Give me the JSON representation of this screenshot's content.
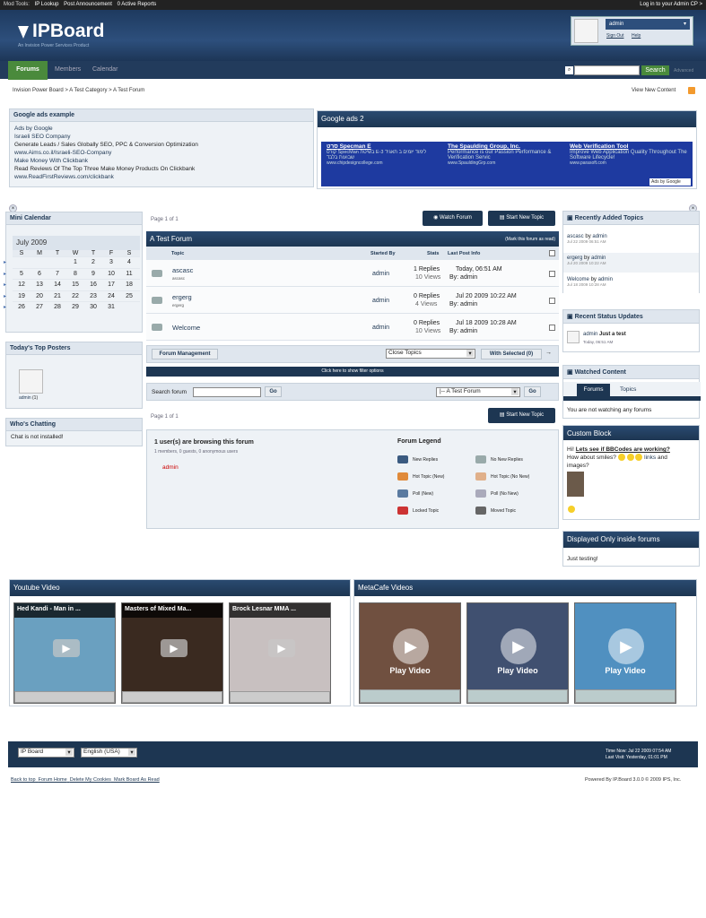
{
  "modbar": {
    "label": "Mod Tools:",
    "links": [
      "IP Lookup",
      "Post Announcement",
      "0 Active Reports"
    ],
    "right": "Log in to your Admin CP >"
  },
  "header": {
    "logo": "IPBoard",
    "logo_sub": "An Invision Power Services Product",
    "username": "admin",
    "sign_out": "Sign Out",
    "help": "Help"
  },
  "nav": {
    "tabs": [
      "Forums",
      "Members",
      "Calendar"
    ],
    "search_placeholder": "",
    "search_button": "Search",
    "advanced": "Advanced"
  },
  "breadcrumb": [
    "Invision Power Board",
    "A Test Category",
    "A Test Forum"
  ],
  "view_new": "View New Content",
  "google1": {
    "title": "Google ads example",
    "lines": [
      "Ads by Google",
      "Israeli SEO Company",
      "Generate Leads / Sales Globally SEO, PPC & Conversion Optimization",
      "www.Aims.co.il/Israeli-SEO-Company",
      "Make Money With Clickbank",
      "Read Reviews Of The Top Three Make Money Products On Clickbank",
      "www.ReadFirstReviews.com/clickbank"
    ]
  },
  "google2": {
    "title": "Google ads 2",
    "ads": [
      {
        "t": "סרט Specman E",
        "d": "קורס SpecMan בשיטת E-לימוד יזמים ב תאגיד 3 שבועות בלבד",
        "u": "www.chipdesigncollege.com"
      },
      {
        "t": "The Spaulding Group, Inc.",
        "d": "Performance is our Passion Performance & Verification Servic",
        "u": "www.SpauldingGrp.com"
      },
      {
        "t": "Web Verification Tool",
        "d": "Improve Web Application Quality Throughout The Software Lifecycle!",
        "u": "www.parasoft.com"
      }
    ],
    "footer": "Ads by Google"
  },
  "calendar": {
    "title": "Mini Calendar",
    "month": "July 2009",
    "days": [
      "S",
      "M",
      "T",
      "W",
      "T",
      "F",
      "S"
    ],
    "weeks": [
      [
        "",
        "",
        "",
        "1",
        "2",
        "3",
        "4"
      ],
      [
        "5",
        "6",
        "7",
        "8",
        "9",
        "10",
        "11"
      ],
      [
        "12",
        "13",
        "14",
        "15",
        "16",
        "17",
        "18"
      ],
      [
        "19",
        "20",
        "21",
        "22",
        "23",
        "24",
        "25"
      ],
      [
        "26",
        "27",
        "28",
        "29",
        "30",
        "31",
        ""
      ]
    ]
  },
  "top_posters": {
    "title": "Today's Top Posters",
    "name": "admin",
    "count": "(1)"
  },
  "chatting": {
    "title": "Who's Chatting",
    "text": "Chat is not installed!"
  },
  "forum": {
    "page": "Page 1 of 1",
    "watch": "Watch Forum",
    "start": "Start New Topic",
    "title": "A Test Forum",
    "mark": "(Mark this forum as read)",
    "cols": [
      "Topic",
      "Started By",
      "Stats",
      "Last Post Info"
    ],
    "topics": [
      {
        "name": "ascasc",
        "sub": "ascasc",
        "by": "admin",
        "replies": "1 Replies",
        "views": "10 Views",
        "date": "Today, 06:51 AM",
        "last": "By: admin"
      },
      {
        "name": "ergerg",
        "sub": "ergerg",
        "by": "admin",
        "replies": "0 Replies",
        "views": "4 Views",
        "date": "Jul 20 2009 10:22 AM",
        "last": "By: admin"
      },
      {
        "name": "Welcome",
        "sub": "",
        "by": "admin",
        "replies": "0 Replies",
        "views": "10 Views",
        "date": "Jul 18 2009 10:28 AM",
        "last": "By: admin"
      }
    ],
    "manage": "Forum Management",
    "close": "Close Topics",
    "with_selected": "With Selected (0)",
    "filter": "Click here to show filter options",
    "search_label": "Search forum",
    "go": "Go",
    "jump": "|-- A Test Forum",
    "go2": "Go",
    "page2": "Page 1 of 1",
    "start2": "Start New Topic"
  },
  "browsing": {
    "title": "1 user(s) are browsing this forum",
    "sub": "1 members, 0 guests, 0 anonymous users",
    "user": "admin"
  },
  "legend": {
    "title": "Forum Legend",
    "items": [
      "New Replies",
      "No New Replies",
      "Hot Topic (New)",
      "Hot Topic (No New)",
      "Poll (New)",
      "Poll (No New)",
      "Locked Topic",
      "Moved Topic"
    ]
  },
  "recent": {
    "title": "Recently Added Topics",
    "items": [
      {
        "t": "ascasc",
        "by": "admin",
        "d": "Jul 22 2009 06:51 AM"
      },
      {
        "t": "ergerg",
        "by": "admin",
        "d": "Jul 20 2009 10:22 AM"
      },
      {
        "t": "Welcome",
        "by": "admin",
        "d": "Jul 18 2009 10:28 AM"
      }
    ]
  },
  "status": {
    "title": "Recent Status Updates",
    "user": "admin",
    "text": "Just a test",
    "date": "Today, 06:51 AM"
  },
  "watched": {
    "title": "Watched Content",
    "tabs": [
      "Forums",
      "Topics"
    ],
    "text": "You are not watching any forums"
  },
  "custom": {
    "title": "Custom Block",
    "hi": "Hi!",
    "link": "Lets see if BBCodes are working?",
    "line2": "How about smiles?",
    "links": "links",
    "and": "and",
    "images": "images?"
  },
  "displayed": {
    "title": "Displayed Only inside forums",
    "text": "Just testing!"
  },
  "youtube": {
    "title": "Youtube Video",
    "videos": [
      "Hed Kandi - Man in ...",
      "Masters of Mixed Ma...",
      "Brock Lesnar MMA ..."
    ]
  },
  "metacafe": {
    "title": "MetaCafe Videos",
    "play": "Play Video"
  },
  "footer": {
    "skin": "IP Board",
    "lang": "English (USA)",
    "time": "Time Now: Jul 22 2009 07:54 AM",
    "visit": "Last Visit: Yesterday, 01:01 PM",
    "links": [
      "Back to top",
      "Forum Home",
      "Delete My Cookies",
      "Mark Board As Read"
    ],
    "powered": "Powered By IP.Board 3.0.0 © 2009  IPS, Inc."
  }
}
